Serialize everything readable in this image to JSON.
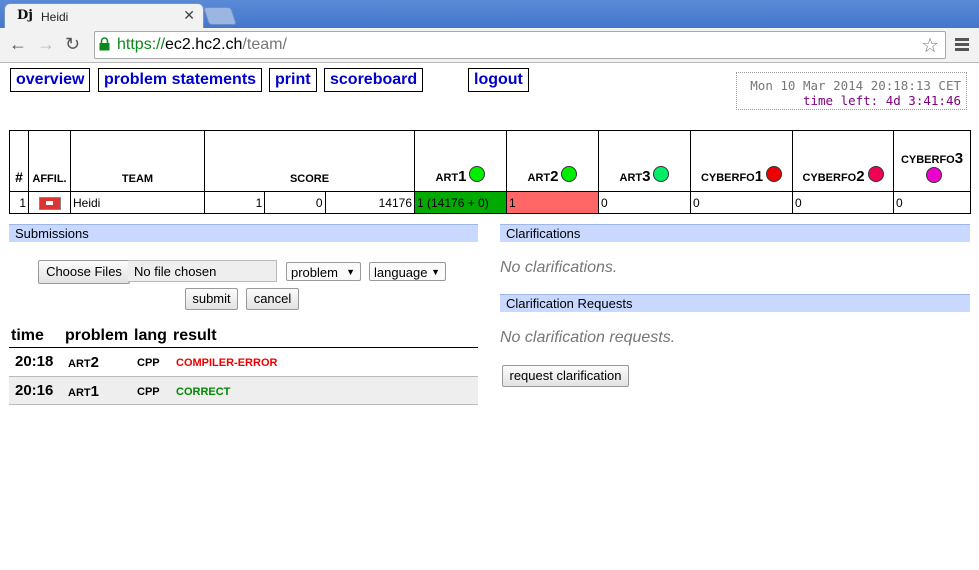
{
  "browser": {
    "tab_title": "Heidi",
    "favicon": "Dj",
    "url_scheme": "https://",
    "url_host": "ec2.hc2.ch",
    "url_path": "/team/"
  },
  "nav": {
    "overview": "overview",
    "problems": "problem statements",
    "print": "print",
    "scoreboard": "scoreboard",
    "logout": "logout"
  },
  "clock": {
    "time": "Mon 10 Mar 2014 20:18:13 CET",
    "left": "time left: 4d 3:41:46"
  },
  "scoreboard": {
    "headers": {
      "rank": "#",
      "affil": "AFFIL.",
      "team": "TEAM",
      "score": "SCORE"
    },
    "problems": [
      {
        "prefix": "ART",
        "num": "1",
        "color": "#00ee00"
      },
      {
        "prefix": "ART",
        "num": "2",
        "color": "#00ee00"
      },
      {
        "prefix": "ART",
        "num": "3",
        "color": "#00ee66"
      },
      {
        "prefix": "CYBERFO",
        "num": "1",
        "color": "#ee0000"
      },
      {
        "prefix": "CYBERFO",
        "num": "2",
        "color": "#ee0055"
      },
      {
        "prefix": "CYBERFO",
        "num": "3",
        "color": "#ee00cc"
      }
    ],
    "row": {
      "rank": "1",
      "team": "Heidi",
      "solved": "1",
      "penalty": "0",
      "time": "14176",
      "cells": [
        "1 (14176 + 0)",
        "1",
        "0",
        "0",
        "0",
        "0"
      ],
      "cell_colors": [
        "#00aa00",
        "#ff6666",
        "",
        "",
        "",
        ""
      ]
    }
  },
  "submissions": {
    "title": "Submissions",
    "choose_files": "Choose Files",
    "no_file": "No file chosen",
    "problem_select": "problem",
    "language_select": "language",
    "submit": "submit",
    "cancel": "cancel",
    "col_time": "time",
    "col_problem": "problem",
    "col_lang": "lang",
    "col_result": "result",
    "rows": [
      {
        "time": "20:18",
        "prob_prefix": "ART",
        "prob_num": "2",
        "lang": "CPP",
        "result": "COMPILER-ERROR",
        "result_color": "#ee0000"
      },
      {
        "time": "20:16",
        "prob_prefix": "ART",
        "prob_num": "1",
        "lang": "CPP",
        "result": "CORRECT",
        "result_color": "#008800"
      }
    ]
  },
  "clarifications": {
    "title": "Clarifications",
    "empty": "No clarifications.",
    "requests_title": "Clarification Requests",
    "requests_empty": "No clarification requests.",
    "request_button": "request clarification"
  }
}
